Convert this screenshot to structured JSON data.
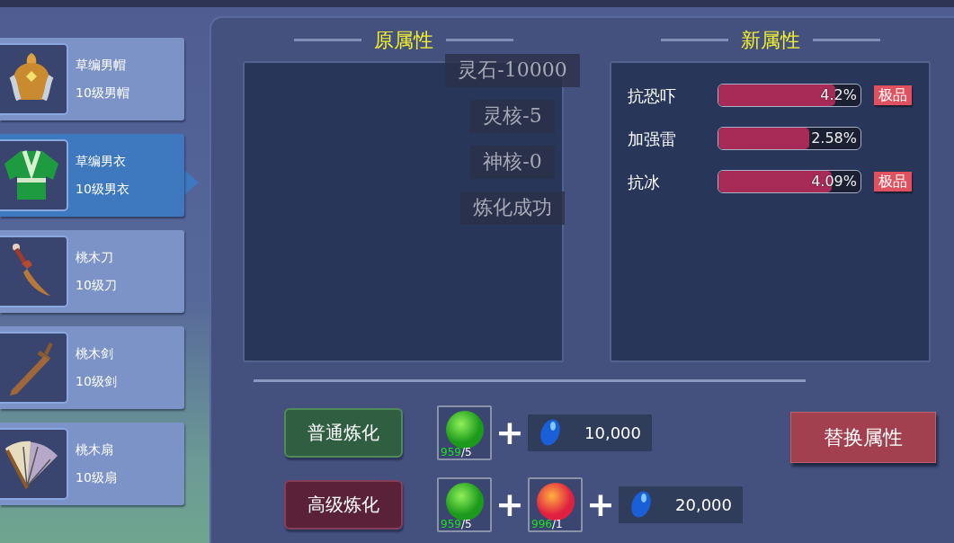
{
  "sidebar": {
    "items": [
      {
        "name": "草编男帽",
        "level": "10级男帽",
        "selected": false,
        "kind": "helmet"
      },
      {
        "name": "草编男衣",
        "level": "10级男衣",
        "selected": true,
        "kind": "robe"
      },
      {
        "name": "桃木刀",
        "level": "10级刀",
        "selected": false,
        "kind": "saber"
      },
      {
        "name": "桃木剑",
        "level": "10级剑",
        "selected": false,
        "kind": "sword"
      },
      {
        "name": "桃木扇",
        "level": "10级扇",
        "selected": false,
        "kind": "fan"
      }
    ]
  },
  "original_attributes": {
    "title": "原属性"
  },
  "new_attributes": {
    "title": "新属性",
    "stats": [
      {
        "name": "抗恐吓",
        "value": "4.2%",
        "level": 0.82,
        "badge": "极品"
      },
      {
        "name": "加强雷",
        "value": "2.58%",
        "level": 0.64
      },
      {
        "name": "抗冰",
        "value": "4.09%",
        "level": 0.8,
        "badge": "极品"
      }
    ]
  },
  "toasts": [
    "灵石-10000",
    "灵核-5",
    "神核-0",
    "炼化成功"
  ],
  "refine_options": [
    {
      "kind": "normal",
      "button": "普通炼化",
      "materials": [
        {
          "kind": "green",
          "owned": "959",
          "required": "/5"
        }
      ],
      "plus_signs": [
        "+"
      ],
      "cost": "10,000"
    },
    {
      "kind": "advanced",
      "button": "高级炼化",
      "materials": [
        {
          "kind": "green",
          "owned": "959",
          "required": "/5"
        },
        {
          "kind": "red",
          "owned": "996",
          "required": "/1"
        }
      ],
      "plus_signs": [
        "+",
        "+"
      ],
      "cost": "20,000"
    }
  ],
  "replace_button": "替换属性"
}
